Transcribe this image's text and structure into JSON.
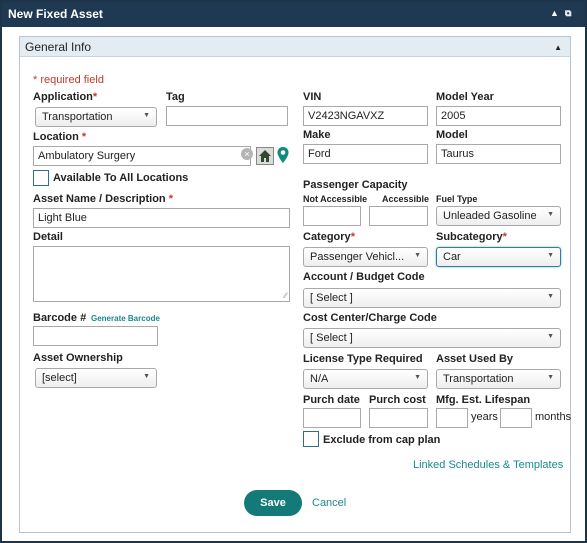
{
  "window": {
    "title": "New Fixed Asset"
  },
  "panel": {
    "title": "General Info"
  },
  "required_note": "* required field",
  "left": {
    "application": {
      "label": "Application",
      "value": "Transportation"
    },
    "tag": {
      "label": "Tag",
      "value": ""
    },
    "location": {
      "label": "Location",
      "value": "Ambulatory Surgery"
    },
    "available_all": {
      "label": "Available To All Locations",
      "checked": false
    },
    "asset_name": {
      "label": "Asset Name / Description",
      "value": "Light Blue"
    },
    "detail": {
      "label": "Detail",
      "value": ""
    },
    "barcode": {
      "label": "Barcode #",
      "generate_label": "Generate Barcode",
      "value": ""
    },
    "ownership": {
      "label": "Asset Ownership",
      "value": "[select]"
    }
  },
  "right": {
    "vin": {
      "label": "VIN",
      "value": "V2423NGAVXZ"
    },
    "model_year": {
      "label": "Model Year",
      "value": "2005"
    },
    "make": {
      "label": "Make",
      "value": "Ford"
    },
    "model": {
      "label": "Model",
      "value": "Taurus"
    },
    "passenger_capacity": {
      "label": "Passenger Capacity",
      "not_accessible_label": "Not Accessible",
      "accessible_label": "Accessible",
      "not_accessible_value": "",
      "accessible_value": ""
    },
    "fuel_type": {
      "label": "Fuel Type",
      "value": "Unleaded Gasoline"
    },
    "category": {
      "label": "Category",
      "value": "Passenger Vehicl..."
    },
    "subcategory": {
      "label": "Subcategory",
      "value": "Car"
    },
    "account_budget": {
      "label": "Account / Budget Code",
      "value": "[ Select ]"
    },
    "cost_center": {
      "label": "Cost Center/Charge Code",
      "value": "[ Select ]"
    },
    "license_type": {
      "label": "License Type Required",
      "value": "N/A"
    },
    "asset_used_by": {
      "label": "Asset Used By",
      "value": "Transportation"
    },
    "purch_date": {
      "label": "Purch date",
      "value": ""
    },
    "purch_cost": {
      "label": "Purch cost",
      "value": ""
    },
    "lifespan": {
      "label": "Mfg. Est. Lifespan",
      "years_label": "years",
      "months_label": "months",
      "years": "",
      "months": ""
    },
    "exclude_cap": {
      "label": "Exclude from cap plan",
      "checked": false
    },
    "linked_schedules": "Linked Schedules & Templates"
  },
  "actions": {
    "save": "Save",
    "cancel": "Cancel"
  },
  "colors": {
    "titlebar": "#1f3953",
    "accent": "#137a78",
    "required": "#c0392b"
  }
}
